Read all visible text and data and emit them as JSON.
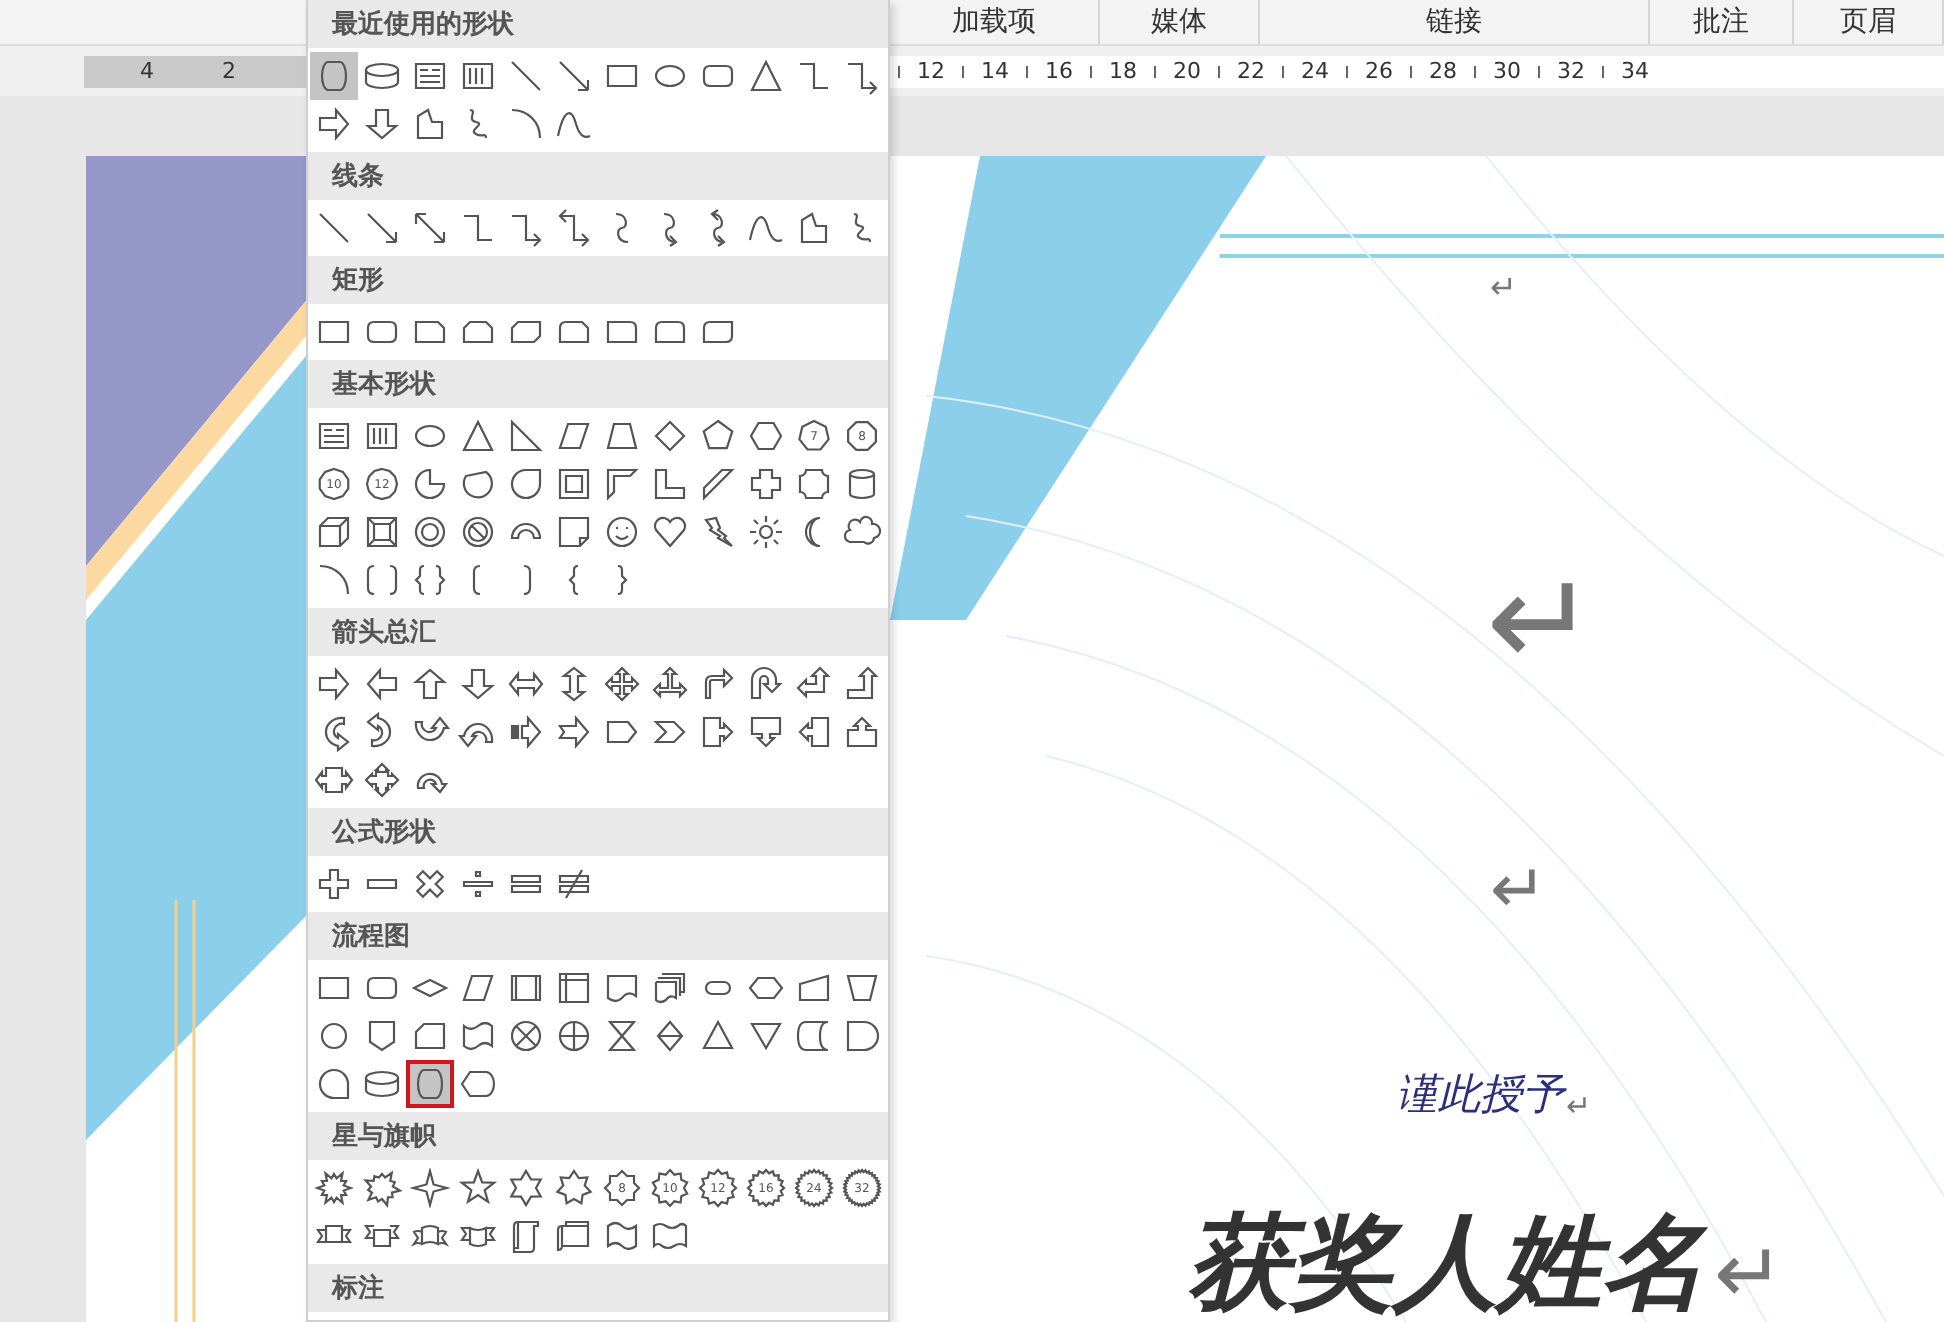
{
  "ribbon_tabs": [
    "加载项",
    "媒体",
    "链接",
    "批注",
    "页眉"
  ],
  "ruler": {
    "left_labels": [
      "4",
      "2"
    ],
    "right_labels": [
      "12",
      "14",
      "16",
      "18",
      "20",
      "22",
      "24",
      "26",
      "28",
      "30",
      "32",
      "34"
    ]
  },
  "shape_menu": {
    "sections": [
      {
        "title": "最近使用的形状",
        "shapes": [
          {
            "kind": "horizontal-cylinder",
            "selected": true
          },
          {
            "kind": "cylinder",
            "selected": false
          },
          {
            "kind": "textbox",
            "selected": false
          },
          {
            "kind": "vertical-textbox",
            "selected": false
          },
          {
            "kind": "line",
            "selected": false
          },
          {
            "kind": "arrow-line",
            "selected": false
          },
          {
            "kind": "rectangle",
            "selected": false
          },
          {
            "kind": "ellipse",
            "selected": false
          },
          {
            "kind": "rounded-rectangle",
            "selected": false
          },
          {
            "kind": "triangle",
            "selected": false
          },
          {
            "kind": "elbow-connector",
            "selected": false
          },
          {
            "kind": "elbow-arrow",
            "selected": false
          },
          {
            "kind": "right-arrow",
            "selected": false
          },
          {
            "kind": "down-arrow",
            "selected": false
          },
          {
            "kind": "freeform",
            "selected": false
          },
          {
            "kind": "scribble",
            "selected": false
          },
          {
            "kind": "arc",
            "selected": false
          },
          {
            "kind": "curve",
            "selected": false
          }
        ]
      },
      {
        "title": "线条",
        "shapes": [
          {
            "kind": "line",
            "selected": false
          },
          {
            "kind": "arrow-line",
            "selected": false
          },
          {
            "kind": "double-arrow-line",
            "selected": false
          },
          {
            "kind": "elbow-connector",
            "selected": false
          },
          {
            "kind": "elbow-arrow",
            "selected": false
          },
          {
            "kind": "elbow-double-arrow",
            "selected": false
          },
          {
            "kind": "curved-connector",
            "selected": false
          },
          {
            "kind": "curved-arrow",
            "selected": false
          },
          {
            "kind": "curved-double-arrow",
            "selected": false
          },
          {
            "kind": "curve",
            "selected": false
          },
          {
            "kind": "freeform",
            "selected": false
          },
          {
            "kind": "scribble",
            "selected": false
          }
        ]
      },
      {
        "title": "矩形",
        "shapes": [
          {
            "kind": "rectangle",
            "selected": false
          },
          {
            "kind": "rounded-rectangle",
            "selected": false
          },
          {
            "kind": "snip-corner-rectangle",
            "selected": false
          },
          {
            "kind": "snip-two-rectangle",
            "selected": false
          },
          {
            "kind": "snip-diagonal-rectangle",
            "selected": false
          },
          {
            "kind": "snip-round-rectangle",
            "selected": false
          },
          {
            "kind": "round-corner-rectangle",
            "selected": false
          },
          {
            "kind": "round-two-rectangle",
            "selected": false
          },
          {
            "kind": "round-diagonal-rectangle",
            "selected": false
          }
        ]
      },
      {
        "title": "基本形状",
        "shapes": [
          {
            "kind": "textbox",
            "selected": false
          },
          {
            "kind": "vertical-textbox",
            "selected": false
          },
          {
            "kind": "ellipse",
            "selected": false
          },
          {
            "kind": "triangle",
            "selected": false
          },
          {
            "kind": "right-triangle",
            "selected": false
          },
          {
            "kind": "parallelogram",
            "selected": false
          },
          {
            "kind": "trapezoid",
            "selected": false
          },
          {
            "kind": "diamond",
            "selected": false
          },
          {
            "kind": "pentagon",
            "selected": false
          },
          {
            "kind": "hexagon",
            "selected": false
          },
          {
            "kind": "heptagon",
            "selected": false,
            "label": "7"
          },
          {
            "kind": "octagon",
            "selected": false,
            "label": "8"
          },
          {
            "kind": "decagon",
            "selected": false,
            "label": "10"
          },
          {
            "kind": "dodecagon",
            "selected": false,
            "label": "12"
          },
          {
            "kind": "pie",
            "selected": false
          },
          {
            "kind": "chord",
            "selected": false
          },
          {
            "kind": "teardrop",
            "selected": false
          },
          {
            "kind": "frame",
            "selected": false
          },
          {
            "kind": "half-frame",
            "selected": false
          },
          {
            "kind": "l-shape",
            "selected": false
          },
          {
            "kind": "diagonal-stripe",
            "selected": false
          },
          {
            "kind": "cross",
            "selected": false
          },
          {
            "kind": "plaque",
            "selected": false
          },
          {
            "kind": "can",
            "selected": false
          },
          {
            "kind": "cube",
            "selected": false
          },
          {
            "kind": "bevel",
            "selected": false
          },
          {
            "kind": "donut",
            "selected": false
          },
          {
            "kind": "no-symbol",
            "selected": false
          },
          {
            "kind": "block-arc",
            "selected": false
          },
          {
            "kind": "folded-corner",
            "selected": false
          },
          {
            "kind": "smiley",
            "selected": false
          },
          {
            "kind": "heart",
            "selected": false
          },
          {
            "kind": "lightning",
            "selected": false
          },
          {
            "kind": "sun",
            "selected": false
          },
          {
            "kind": "moon",
            "selected": false
          },
          {
            "kind": "cloud",
            "selected": false
          },
          {
            "kind": "arc",
            "selected": false
          },
          {
            "kind": "double-bracket",
            "selected": false
          },
          {
            "kind": "double-brace",
            "selected": false
          },
          {
            "kind": "left-bracket",
            "selected": false
          },
          {
            "kind": "right-bracket",
            "selected": false
          },
          {
            "kind": "left-brace",
            "selected": false
          },
          {
            "kind": "right-brace",
            "selected": false
          }
        ]
      },
      {
        "title": "箭头总汇",
        "shapes": [
          {
            "kind": "right-arrow",
            "selected": false
          },
          {
            "kind": "left-arrow",
            "selected": false
          },
          {
            "kind": "up-arrow",
            "selected": false
          },
          {
            "kind": "down-arrow",
            "selected": false
          },
          {
            "kind": "left-right-arrow",
            "selected": false
          },
          {
            "kind": "up-down-arrow",
            "selected": false
          },
          {
            "kind": "quad-arrow",
            "selected": false
          },
          {
            "kind": "left-right-up-arrow",
            "selected": false
          },
          {
            "kind": "bent-arrow",
            "selected": false
          },
          {
            "kind": "u-turn-arrow",
            "selected": false
          },
          {
            "kind": "left-up-arrow",
            "selected": false
          },
          {
            "kind": "bent-up-arrow",
            "selected": false
          },
          {
            "kind": "curved-right-arrow",
            "selected": false
          },
          {
            "kind": "curved-left-arrow",
            "selected": false
          },
          {
            "kind": "curved-up-arrow",
            "selected": false
          },
          {
            "kind": "curved-down-arrow",
            "selected": false
          },
          {
            "kind": "striped-right-arrow",
            "selected": false
          },
          {
            "kind": "notched-right-arrow",
            "selected": false
          },
          {
            "kind": "pentagon-arrow",
            "selected": false
          },
          {
            "kind": "chevron",
            "selected": false
          },
          {
            "kind": "right-arrow-callout",
            "selected": false
          },
          {
            "kind": "down-arrow-callout",
            "selected": false
          },
          {
            "kind": "left-arrow-callout",
            "selected": false
          },
          {
            "kind": "up-arrow-callout",
            "selected": false
          },
          {
            "kind": "left-right-arrow-callout",
            "selected": false
          },
          {
            "kind": "quad-arrow-callout",
            "selected": false
          },
          {
            "kind": "circular-arrow",
            "selected": false
          }
        ]
      },
      {
        "title": "公式形状",
        "shapes": [
          {
            "kind": "plus",
            "selected": false
          },
          {
            "kind": "minus",
            "selected": false
          },
          {
            "kind": "multiply",
            "selected": false
          },
          {
            "kind": "divide",
            "selected": false
          },
          {
            "kind": "equal",
            "selected": false
          },
          {
            "kind": "not-equal",
            "selected": false
          }
        ]
      },
      {
        "title": "流程图",
        "shapes": [
          {
            "kind": "rectangle",
            "selected": false,
            "highlighted": false
          },
          {
            "kind": "rounded-rectangle",
            "selected": false,
            "highlighted": false
          },
          {
            "kind": "flat-diamond",
            "selected": false,
            "highlighted": false
          },
          {
            "kind": "parallelogram",
            "selected": false,
            "highlighted": false
          },
          {
            "kind": "predefined-process",
            "selected": false,
            "highlighted": false
          },
          {
            "kind": "internal-storage",
            "selected": false,
            "highlighted": false
          },
          {
            "kind": "document",
            "selected": false,
            "highlighted": false
          },
          {
            "kind": "multidocument",
            "selected": false,
            "highlighted": false
          },
          {
            "kind": "terminator",
            "selected": false,
            "highlighted": false
          },
          {
            "kind": "preparation",
            "selected": false,
            "highlighted": false
          },
          {
            "kind": "manual-input",
            "selected": false,
            "highlighted": false
          },
          {
            "kind": "manual-operation",
            "selected": false,
            "highlighted": false
          },
          {
            "kind": "circle",
            "selected": false,
            "highlighted": false
          },
          {
            "kind": "offpage-connector",
            "selected": false,
            "highlighted": false
          },
          {
            "kind": "card",
            "selected": false,
            "highlighted": false
          },
          {
            "kind": "punched-tape",
            "selected": false,
            "highlighted": false
          },
          {
            "kind": "summing-junction",
            "selected": false,
            "highlighted": false
          },
          {
            "kind": "or-symbol",
            "selected": false,
            "highlighted": false
          },
          {
            "kind": "collate",
            "selected": false,
            "highlighted": false
          },
          {
            "kind": "sort",
            "selected": false,
            "highlighted": false
          },
          {
            "kind": "extract",
            "selected": false,
            "highlighted": false
          },
          {
            "kind": "merge",
            "selected": false,
            "highlighted": false
          },
          {
            "kind": "stored-data",
            "selected": false,
            "highlighted": false
          },
          {
            "kind": "delay",
            "selected": false,
            "highlighted": false
          },
          {
            "kind": "sequential-access",
            "selected": false,
            "highlighted": false
          },
          {
            "kind": "cylinder",
            "selected": false,
            "highlighted": false
          },
          {
            "kind": "horizontal-cylinder",
            "selected": true,
            "highlighted": true
          },
          {
            "kind": "display",
            "selected": false,
            "highlighted": false
          }
        ]
      },
      {
        "title": "星与旗帜",
        "shapes": [
          {
            "kind": "burst",
            "selected": false
          },
          {
            "kind": "burst-wide",
            "selected": false
          },
          {
            "kind": "four-point-star",
            "selected": false
          },
          {
            "kind": "five-point-star",
            "selected": false
          },
          {
            "kind": "six-point-star",
            "selected": false
          },
          {
            "kind": "seven-point-star",
            "selected": false
          },
          {
            "kind": "eight-point-star",
            "selected": false,
            "label": "8"
          },
          {
            "kind": "ten-point-star",
            "selected": false,
            "label": "10"
          },
          {
            "kind": "twelve-point-star",
            "selected": false,
            "label": "12"
          },
          {
            "kind": "sixteen-point-star",
            "selected": false,
            "label": "16"
          },
          {
            "kind": "twenty-four-point-star",
            "selected": false,
            "label": "24"
          },
          {
            "kind": "thirty-two-point-star",
            "selected": false,
            "label": "32"
          },
          {
            "kind": "ribbon-down",
            "selected": false
          },
          {
            "kind": "ribbon-up",
            "selected": false
          },
          {
            "kind": "curved-ribbon-down",
            "selected": false
          },
          {
            "kind": "curved-ribbon-up",
            "selected": false
          },
          {
            "kind": "vertical-scroll",
            "selected": false
          },
          {
            "kind": "horizontal-scroll",
            "selected": false
          },
          {
            "kind": "wave",
            "selected": false
          },
          {
            "kind": "double-wave",
            "selected": false
          }
        ]
      },
      {
        "title": "标注"
      }
    ]
  },
  "document": {
    "paragraph_marks": [
      "↵",
      "↵",
      "↵"
    ],
    "grant_line": {
      "text": "谨此授予",
      "mark": "↵"
    },
    "recipient_name": {
      "text": "获奖人姓名",
      "mark": "↵"
    }
  }
}
